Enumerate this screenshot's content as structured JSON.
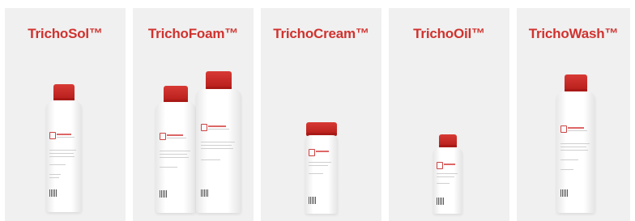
{
  "products": [
    {
      "name": "TrichoSol™",
      "icon": "bottle-icon"
    },
    {
      "name": "TrichoFoam™",
      "icon": "bottle-pair-icon"
    },
    {
      "name": "TrichoCream™",
      "icon": "jar-icon"
    },
    {
      "name": "TrichoOil™",
      "icon": "small-bottle-icon"
    },
    {
      "name": "TrichoWash™",
      "icon": "bottle-icon"
    }
  ],
  "colors": {
    "title": "#d0322e",
    "card_bg": "#f0f0f0",
    "cap": "#c8282a"
  }
}
